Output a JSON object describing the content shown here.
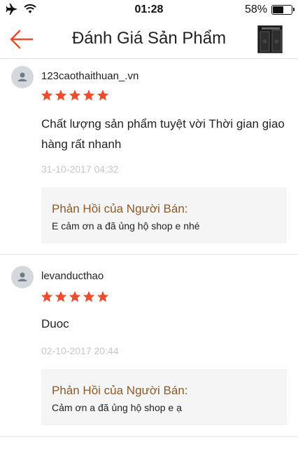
{
  "status_bar": {
    "time": "01:28",
    "battery_percent": "58%",
    "battery_level": 0.58,
    "icons": [
      "airplane-mode-icon",
      "wifi-icon",
      "battery-icon"
    ]
  },
  "header": {
    "title": "Đánh Giá Sản Phẩm",
    "back_icon": "back-arrow-icon"
  },
  "colors": {
    "accent": "#ee4d2d",
    "reply_title": "#8b5a2b",
    "date": "#c8c8c8",
    "reply_bg": "#f5f5f5"
  },
  "reviews": [
    {
      "username": "123caothaithuan_.vn",
      "rating": 5,
      "text": "Chất lượng sản phẩm tuyệt vời Thời gian giao hàng rất nhanh",
      "date": "31-10-2017 04:32",
      "reply_title": "Phản Hồi của Người Bán:",
      "reply_text": "E cảm ơn a đã ủng hộ shop e nhé"
    },
    {
      "username": "levanducthao",
      "rating": 5,
      "text": "Duoc",
      "date": "02-10-2017 20:44",
      "reply_title": "Phản Hồi của Người Bán:",
      "reply_text": "Cảm ơn a đã ủng hộ shop e ạ"
    }
  ]
}
